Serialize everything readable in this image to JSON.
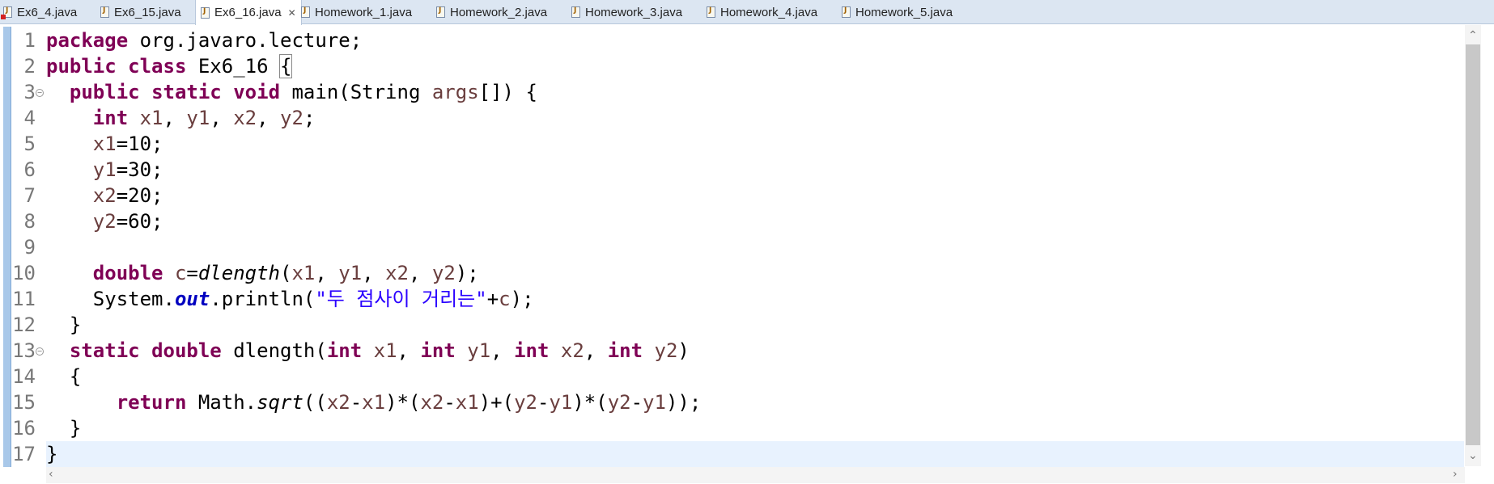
{
  "tabs": [
    {
      "label": "Ex6_4.java",
      "active": false,
      "has_error": true
    },
    {
      "label": "Ex6_15.java",
      "active": false,
      "has_error": false
    },
    {
      "label": "Ex6_16.java",
      "active": true,
      "has_error": false
    },
    {
      "label": "Homework_1.java",
      "active": false,
      "has_error": false
    },
    {
      "label": "Homework_2.java",
      "active": false,
      "has_error": false
    },
    {
      "label": "Homework_3.java",
      "active": false,
      "has_error": false
    },
    {
      "label": "Homework_4.java",
      "active": false,
      "has_error": false
    },
    {
      "label": "Homework_5.java",
      "active": false,
      "has_error": false
    }
  ],
  "tab_close_glyph": "✕",
  "editor": {
    "current_line": 17,
    "line_numbers": [
      "1",
      "2",
      "3",
      "4",
      "5",
      "6",
      "7",
      "8",
      "9",
      "10",
      "11",
      "12",
      "13",
      "14",
      "15",
      "16",
      "17"
    ],
    "folding_lines": [
      3,
      13
    ],
    "lines": [
      [
        {
          "t": "package",
          "c": "kw"
        },
        {
          "t": " org.javaro.lecture;"
        }
      ],
      [
        {
          "t": "public",
          "c": "kw"
        },
        {
          "t": " "
        },
        {
          "t": "class",
          "c": "kw"
        },
        {
          "t": " Ex6_16 "
        },
        {
          "t": "{",
          "c": "brace"
        }
      ],
      [
        {
          "t": "  "
        },
        {
          "t": "public",
          "c": "kw"
        },
        {
          "t": " "
        },
        {
          "t": "static",
          "c": "kw"
        },
        {
          "t": " "
        },
        {
          "t": "void",
          "c": "kw"
        },
        {
          "t": " main(String "
        },
        {
          "t": "args",
          "c": "var"
        },
        {
          "t": "[]) {"
        }
      ],
      [
        {
          "t": "    "
        },
        {
          "t": "int",
          "c": "kw"
        },
        {
          "t": " "
        },
        {
          "t": "x1",
          "c": "var"
        },
        {
          "t": ", "
        },
        {
          "t": "y1",
          "c": "var"
        },
        {
          "t": ", "
        },
        {
          "t": "x2",
          "c": "var"
        },
        {
          "t": ", "
        },
        {
          "t": "y2",
          "c": "var"
        },
        {
          "t": ";"
        }
      ],
      [
        {
          "t": "    "
        },
        {
          "t": "x1",
          "c": "var"
        },
        {
          "t": "=10;"
        }
      ],
      [
        {
          "t": "    "
        },
        {
          "t": "y1",
          "c": "var"
        },
        {
          "t": "=30;"
        }
      ],
      [
        {
          "t": "    "
        },
        {
          "t": "x2",
          "c": "var"
        },
        {
          "t": "=20;"
        }
      ],
      [
        {
          "t": "    "
        },
        {
          "t": "y2",
          "c": "var"
        },
        {
          "t": "=60;"
        }
      ],
      [
        {
          "t": ""
        }
      ],
      [
        {
          "t": "    "
        },
        {
          "t": "double",
          "c": "kw"
        },
        {
          "t": " "
        },
        {
          "t": "c",
          "c": "var"
        },
        {
          "t": "="
        },
        {
          "t": "dlength",
          "c": "it"
        },
        {
          "t": "("
        },
        {
          "t": "x1",
          "c": "var"
        },
        {
          "t": ", "
        },
        {
          "t": "y1",
          "c": "var"
        },
        {
          "t": ", "
        },
        {
          "t": "x2",
          "c": "var"
        },
        {
          "t": ", "
        },
        {
          "t": "y2",
          "c": "var"
        },
        {
          "t": ");"
        }
      ],
      [
        {
          "t": "    System."
        },
        {
          "t": "out",
          "c": "fld"
        },
        {
          "t": ".println("
        },
        {
          "t": "\"두 점사이 거리는\"",
          "c": "str"
        },
        {
          "t": "+"
        },
        {
          "t": "c",
          "c": "var"
        },
        {
          "t": ");"
        }
      ],
      [
        {
          "t": "  }"
        }
      ],
      [
        {
          "t": "  "
        },
        {
          "t": "static",
          "c": "kw"
        },
        {
          "t": " "
        },
        {
          "t": "double",
          "c": "kw"
        },
        {
          "t": " dlength("
        },
        {
          "t": "int",
          "c": "kw"
        },
        {
          "t": " "
        },
        {
          "t": "x1",
          "c": "var"
        },
        {
          "t": ", "
        },
        {
          "t": "int",
          "c": "kw"
        },
        {
          "t": " "
        },
        {
          "t": "y1",
          "c": "var"
        },
        {
          "t": ", "
        },
        {
          "t": "int",
          "c": "kw"
        },
        {
          "t": " "
        },
        {
          "t": "x2",
          "c": "var"
        },
        {
          "t": ", "
        },
        {
          "t": "int",
          "c": "kw"
        },
        {
          "t": " "
        },
        {
          "t": "y2",
          "c": "var"
        },
        {
          "t": ")"
        }
      ],
      [
        {
          "t": "  {"
        }
      ],
      [
        {
          "t": "      "
        },
        {
          "t": "return",
          "c": "kw"
        },
        {
          "t": " Math."
        },
        {
          "t": "sqrt",
          "c": "it"
        },
        {
          "t": "(("
        },
        {
          "t": "x2",
          "c": "var"
        },
        {
          "t": "-"
        },
        {
          "t": "x1",
          "c": "var"
        },
        {
          "t": ")*("
        },
        {
          "t": "x2",
          "c": "var"
        },
        {
          "t": "-"
        },
        {
          "t": "x1",
          "c": "var"
        },
        {
          "t": ")+("
        },
        {
          "t": "y2",
          "c": "var"
        },
        {
          "t": "-"
        },
        {
          "t": "y1",
          "c": "var"
        },
        {
          "t": ")*("
        },
        {
          "t": "y2",
          "c": "var"
        },
        {
          "t": "-"
        },
        {
          "t": "y1",
          "c": "var"
        },
        {
          "t": "));"
        }
      ],
      [
        {
          "t": "  }"
        }
      ],
      [
        {
          "t": "}"
        }
      ]
    ]
  },
  "scrollbars": {
    "up_arrow": "⌃",
    "down_arrow": "⌄",
    "left_arrow": "‹",
    "right_arrow": "›"
  }
}
